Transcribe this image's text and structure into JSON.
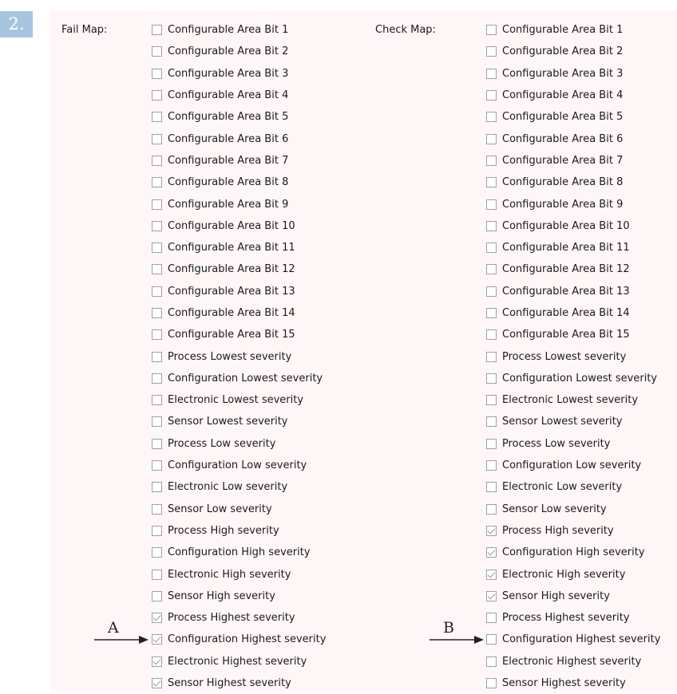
{
  "step_number": "2.",
  "fail_map": {
    "label": "Fail Map:",
    "items": [
      {
        "label": "Configurable Area Bit 1",
        "checked": false
      },
      {
        "label": "Configurable Area Bit 2",
        "checked": false
      },
      {
        "label": "Configurable Area Bit 3",
        "checked": false
      },
      {
        "label": "Configurable Area Bit 4",
        "checked": false
      },
      {
        "label": "Configurable Area Bit 5",
        "checked": false
      },
      {
        "label": "Configurable Area Bit 6",
        "checked": false
      },
      {
        "label": "Configurable Area Bit 7",
        "checked": false
      },
      {
        "label": "Configurable Area Bit 8",
        "checked": false
      },
      {
        "label": "Configurable Area Bit 9",
        "checked": false
      },
      {
        "label": "Configurable Area Bit 10",
        "checked": false
      },
      {
        "label": "Configurable Area Bit 11",
        "checked": false
      },
      {
        "label": "Configurable Area Bit 12",
        "checked": false
      },
      {
        "label": "Configurable Area Bit 13",
        "checked": false
      },
      {
        "label": "Configurable Area Bit 14",
        "checked": false
      },
      {
        "label": "Configurable Area Bit 15",
        "checked": false
      },
      {
        "label": "Process Lowest severity",
        "checked": false
      },
      {
        "label": "Configuration Lowest severity",
        "checked": false
      },
      {
        "label": "Electronic Lowest severity",
        "checked": false
      },
      {
        "label": "Sensor Lowest severity",
        "checked": false
      },
      {
        "label": "Process Low severity",
        "checked": false
      },
      {
        "label": "Configuration Low severity",
        "checked": false
      },
      {
        "label": "Electronic Low severity",
        "checked": false
      },
      {
        "label": "Sensor Low severity",
        "checked": false
      },
      {
        "label": "Process High severity",
        "checked": false
      },
      {
        "label": "Configuration High severity",
        "checked": false
      },
      {
        "label": "Electronic High severity",
        "checked": false
      },
      {
        "label": "Sensor High severity",
        "checked": false
      },
      {
        "label": "Process Highest severity",
        "checked": true
      },
      {
        "label": "Configuration Highest severity",
        "checked": true
      },
      {
        "label": "Electronic Highest severity",
        "checked": true
      },
      {
        "label": "Sensor Highest severity",
        "checked": true
      }
    ]
  },
  "check_map": {
    "label": "Check Map:",
    "items": [
      {
        "label": "Configurable Area Bit 1",
        "checked": false
      },
      {
        "label": "Configurable Area Bit 2",
        "checked": false
      },
      {
        "label": "Configurable Area Bit 3",
        "checked": false
      },
      {
        "label": "Configurable Area Bit 4",
        "checked": false
      },
      {
        "label": "Configurable Area Bit 5",
        "checked": false
      },
      {
        "label": "Configurable Area Bit 6",
        "checked": false
      },
      {
        "label": "Configurable Area Bit 7",
        "checked": false
      },
      {
        "label": "Configurable Area Bit 8",
        "checked": false
      },
      {
        "label": "Configurable Area Bit 9",
        "checked": false
      },
      {
        "label": "Configurable Area Bit 10",
        "checked": false
      },
      {
        "label": "Configurable Area Bit 11",
        "checked": false
      },
      {
        "label": "Configurable Area Bit 12",
        "checked": false
      },
      {
        "label": "Configurable Area Bit 13",
        "checked": false
      },
      {
        "label": "Configurable Area Bit 14",
        "checked": false
      },
      {
        "label": "Configurable Area Bit 15",
        "checked": false
      },
      {
        "label": "Process Lowest severity",
        "checked": false
      },
      {
        "label": "Configuration Lowest severity",
        "checked": false
      },
      {
        "label": "Electronic Lowest severity",
        "checked": false
      },
      {
        "label": "Sensor Lowest severity",
        "checked": false
      },
      {
        "label": "Process Low severity",
        "checked": false
      },
      {
        "label": "Configuration Low severity",
        "checked": false
      },
      {
        "label": "Electronic Low severity",
        "checked": false
      },
      {
        "label": "Sensor Low severity",
        "checked": false
      },
      {
        "label": "Process High severity",
        "checked": true
      },
      {
        "label": "Configuration High severity",
        "checked": true
      },
      {
        "label": "Electronic High severity",
        "checked": true
      },
      {
        "label": "Sensor High severity",
        "checked": true
      },
      {
        "label": "Process Highest severity",
        "checked": false
      },
      {
        "label": "Configuration Highest severity",
        "checked": false
      },
      {
        "label": "Electronic Highest severity",
        "checked": false
      },
      {
        "label": "Sensor Highest severity",
        "checked": false
      }
    ]
  },
  "callouts": {
    "a": "A",
    "b": "B"
  }
}
